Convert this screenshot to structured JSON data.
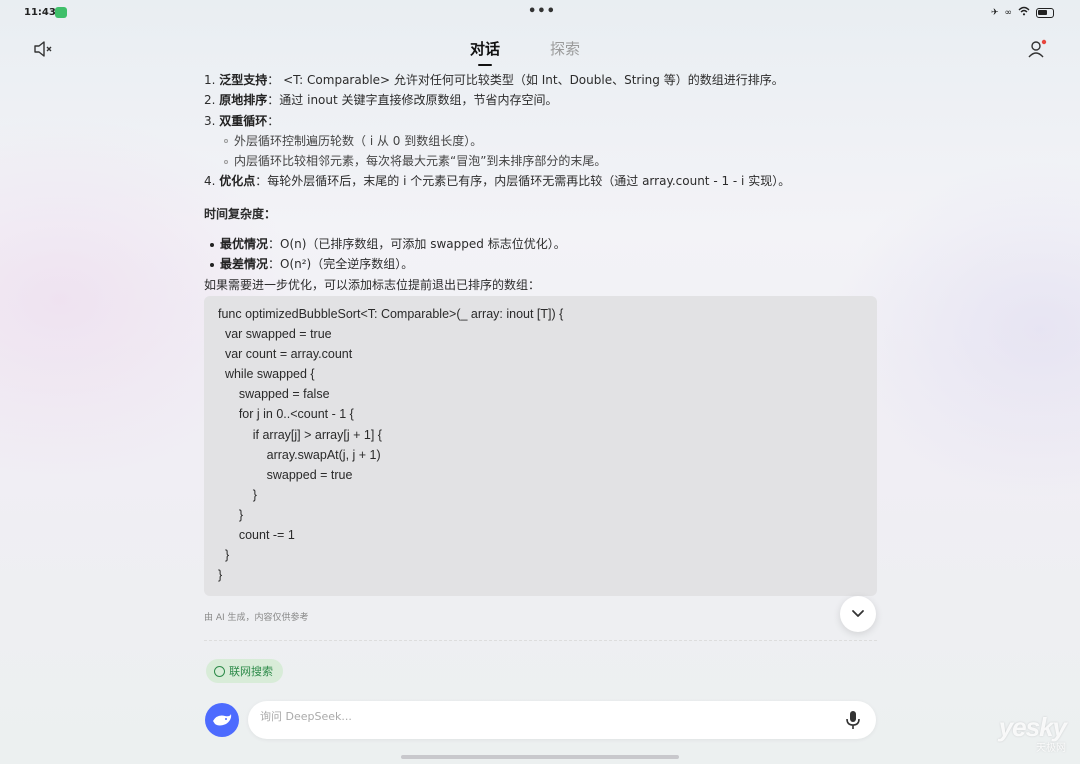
{
  "status_bar": {
    "time": "11:43",
    "dots": "•••"
  },
  "nav": {
    "tabs": [
      {
        "label": "对话",
        "active": true
      },
      {
        "label": "探索",
        "active": false
      }
    ]
  },
  "content": {
    "points": [
      {
        "num": "1.",
        "title": "泛型支持",
        "text": "：  <T: Comparable>  允许对任何可比较类型（如 Int、Double、String 等）的数组进行排序。"
      },
      {
        "num": "2.",
        "title": "原地排序",
        "text": "：通过  inout  关键字直接修改原数组，节省内存空间。"
      },
      {
        "num": "3.",
        "title": "双重循环",
        "text": "："
      },
      {
        "num": "4.",
        "title": "优化点",
        "text": "：每轮外层循环后，末尾的  i  个元素已有序，内层循环无需再比较（通过  array.count - 1 - i  实现）。"
      }
    ],
    "sub_points": [
      "外层循环控制遍历轮数（ i  从 0 到数组长度）。",
      "内层循环比较相邻元素，每次将最大元素“冒泡”到未排序部分的末尾。"
    ],
    "complexity_heading": "时间复杂度：",
    "complexity": [
      {
        "title": "最优情况",
        "text": "：O(n)（已排序数组，可添加  swapped  标志位优化）。"
      },
      {
        "title": "最差情况",
        "text": "：O(n²)（完全逆序数组）。"
      }
    ],
    "followup": "如果需要进一步优化，可以添加标志位提前退出已排序的数组："
  },
  "code": [
    "func optimizedBubbleSort<T: Comparable>(_ array: inout [T]) {",
    "  var swapped = true",
    "  var count = array.count",
    "  while swapped {",
    "      swapped = false",
    "      for j in 0..<count - 1 {",
    "          if array[j] > array[j + 1] {",
    "              array.swapAt(j, j + 1)",
    "              swapped = true",
    "          }",
    "      }",
    "      count -= 1",
    "  }",
    "}"
  ],
  "disclaimer": "由 AI 生成，内容仅供参考",
  "search_chip": "联网搜索",
  "input": {
    "placeholder": "询问 DeepSeek..."
  },
  "watermark": {
    "line1": "yesky",
    "line2": "天极网"
  },
  "colors": {
    "accent": "#4d6bfe",
    "chip_bg": "#d8ecd8",
    "chip_text": "#2e8b4a",
    "code_bg": "#e2e2e4"
  }
}
